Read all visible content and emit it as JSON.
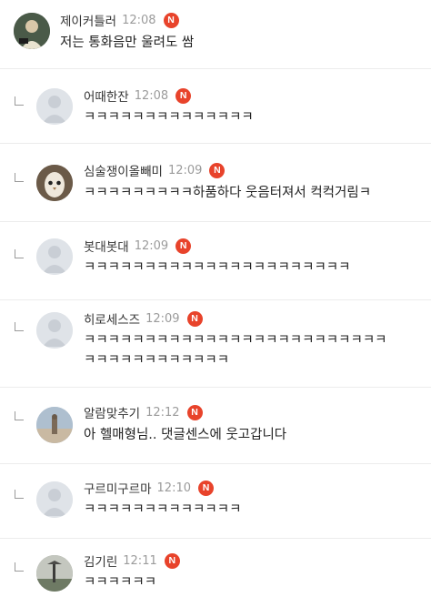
{
  "badge_label": "N",
  "comments": [
    {
      "name": "제이커틀러",
      "time": "12:08",
      "lines": [
        "저는 통화음만 울려도 쌈"
      ]
    },
    {
      "name": "어때한잔",
      "time": "12:08",
      "lines": [
        "ㅋㅋㅋㅋㅋㅋㅋㅋㅋㅋㅋㅋㅋㅋ"
      ]
    },
    {
      "name": "심술쟁이올빼미",
      "time": "12:09",
      "lines": [
        "ㅋㅋㅋㅋㅋㅋㅋㅋㅋ하품하다 웃음터져서 컥컥거림ㅋ"
      ]
    },
    {
      "name": "봇대봇대",
      "time": "12:09",
      "lines": [
        "ㅋㅋㅋㅋㅋㅋㅋㅋㅋㅋㅋㅋㅋㅋㅋㅋㅋㅋㅋㅋㅋㅋ"
      ]
    },
    {
      "name": "히로세스즈",
      "time": "12:09",
      "lines": [
        "ㅋㅋㅋㅋㅋㅋㅋㅋㅋㅋㅋㅋㅋㅋㅋㅋㅋㅋㅋㅋㅋㅋㅋㅋㅋ",
        "ㅋㅋㅋㅋㅋㅋㅋㅋㅋㅋㅋㅋ"
      ]
    },
    {
      "name": "알람맞추기",
      "time": "12:12",
      "lines": [
        "아 헬매형님.. 댓글센스에 웃고갑니다"
      ]
    },
    {
      "name": "구르미구르마",
      "time": "12:10",
      "lines": [
        "ㅋㅋㅋㅋㅋㅋㅋㅋㅋㅋㅋㅋㅋ"
      ]
    },
    {
      "name": "김기린",
      "time": "12:11",
      "lines": [
        "ㅋㅋㅋㅋㅋㅋ"
      ]
    }
  ],
  "colors": {
    "badge": "#e8432b",
    "time": "#9b9b9b",
    "divider": "#ececec"
  }
}
